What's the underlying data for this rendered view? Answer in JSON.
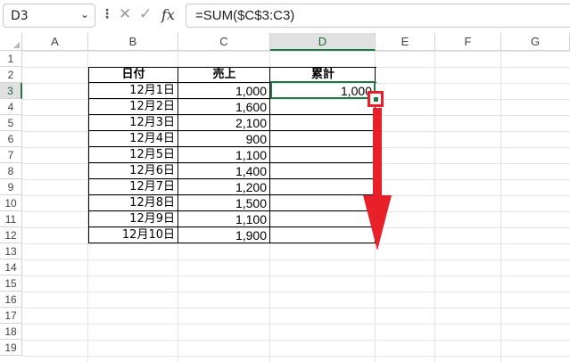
{
  "formula_bar": {
    "name_box": "D3",
    "dropdown_glyph": "⌄",
    "separator_glyph": "⋮",
    "cancel_glyph": "✕",
    "enter_glyph": "✓",
    "fx_glyph": "fx",
    "formula": "=SUM($C$3:C3)"
  },
  "columns": [
    "A",
    "B",
    "C",
    "D",
    "E",
    "F",
    "G"
  ],
  "active_column": "D",
  "rows": [
    "1",
    "2",
    "3",
    "4",
    "5",
    "6",
    "7",
    "8",
    "9",
    "10",
    "11",
    "12",
    "13",
    "14",
    "15",
    "16",
    "17",
    "18",
    "19"
  ],
  "active_row": "3",
  "table": {
    "headers": [
      "日付",
      "売上",
      "累計"
    ],
    "records": [
      {
        "date": "12月1日",
        "sales": "1,000",
        "cumulative": "1,000"
      },
      {
        "date": "12月2日",
        "sales": "1,600",
        "cumulative": ""
      },
      {
        "date": "12月3日",
        "sales": "2,100",
        "cumulative": ""
      },
      {
        "date": "12月4日",
        "sales": "900",
        "cumulative": ""
      },
      {
        "date": "12月5日",
        "sales": "1,100",
        "cumulative": ""
      },
      {
        "date": "12月6日",
        "sales": "1,400",
        "cumulative": ""
      },
      {
        "date": "12月7日",
        "sales": "1,200",
        "cumulative": ""
      },
      {
        "date": "12月8日",
        "sales": "1,500",
        "cumulative": ""
      },
      {
        "date": "12月9日",
        "sales": "1,100",
        "cumulative": ""
      },
      {
        "date": "12月10日",
        "sales": "1,900",
        "cumulative": ""
      }
    ]
  },
  "colors": {
    "selection": "#1f7a45",
    "annotation": "#e8202a"
  },
  "annotation_icons": [
    "fill-handle-highlight",
    "down-arrow-icon"
  ]
}
